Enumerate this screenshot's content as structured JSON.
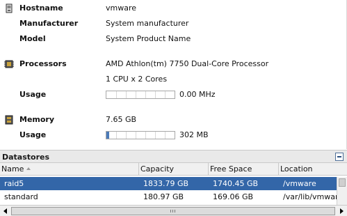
{
  "summary": {
    "hostname": {
      "label": "Hostname",
      "value": "vmware",
      "icon": "server-icon"
    },
    "manufacturer": {
      "label": "Manufacturer",
      "value": "System manufacturer"
    },
    "model": {
      "label": "Model",
      "value": "System Product Name"
    },
    "processors": {
      "label": "Processors",
      "value": "AMD Athlon(tm) 7750 Dual-Core Processor",
      "detail": "1 CPU x 2 Cores",
      "icon": "cpu-icon"
    },
    "cpu_usage": {
      "label": "Usage",
      "value": "0.00 MHz",
      "fraction": 0.0
    },
    "memory": {
      "label": "Memory",
      "value": "7.65 GB",
      "icon": "memory-icon"
    },
    "mem_usage": {
      "label": "Usage",
      "value": "302 MB",
      "fraction": 0.04
    }
  },
  "datastores": {
    "title": "Datastores",
    "columns": [
      "Name",
      "Capacity",
      "Free Space",
      "Location"
    ],
    "sort_column": "Name",
    "rows": [
      {
        "name": "raid5",
        "capacity": "1833.79 GB",
        "free": "1740.45 GB",
        "location": "/vmware",
        "selected": true
      },
      {
        "name": "standard",
        "capacity": "180.97 GB",
        "free": "169.06 GB",
        "location": "/var/lib/vmware",
        "selected": false
      }
    ]
  },
  "colors": {
    "selection": "#3366a8",
    "meter_fill": "#4b7ab8"
  }
}
